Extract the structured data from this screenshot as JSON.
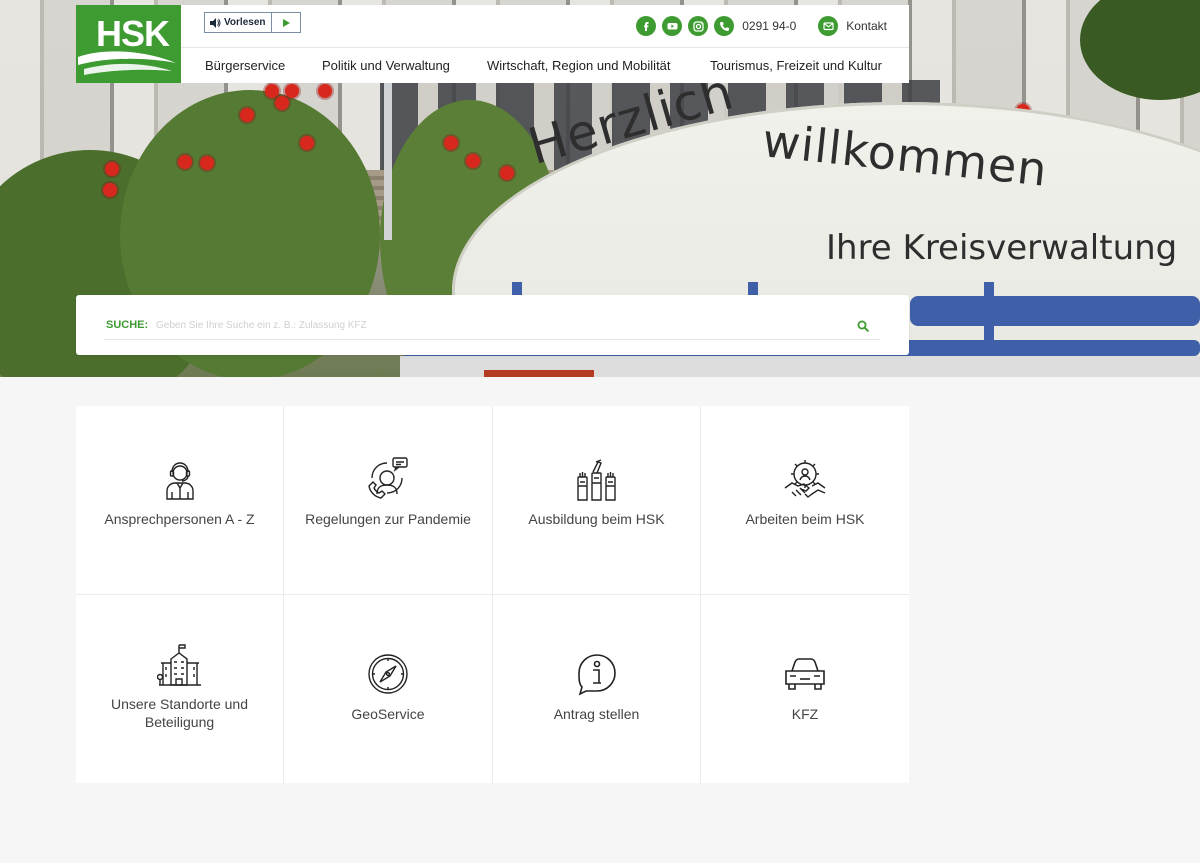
{
  "hero": {
    "sign_line1": "Herzlich",
    "sign_line2": "willkommen",
    "sign_line3": "Ihre Kreisverwaltung"
  },
  "logo": {
    "text": "HSK"
  },
  "vorlesen": {
    "label": "Vorlesen",
    "icon": "speaker-icon",
    "play_icon": "play-icon"
  },
  "topbar": {
    "social": [
      {
        "name": "facebook",
        "icon": "facebook-icon"
      },
      {
        "name": "youtube",
        "icon": "youtube-icon"
      },
      {
        "name": "instagram",
        "icon": "instagram-icon"
      }
    ],
    "phone": "0291 94-0",
    "contact": "Kontakt"
  },
  "nav": {
    "items": [
      {
        "label": "Bürgerservice"
      },
      {
        "label": "Politik und Verwaltung"
      },
      {
        "label": "Wirtschaft, Region und Mobilität"
      },
      {
        "label": "Tourismus, Freizeit und Kultur"
      }
    ]
  },
  "search": {
    "label": "SUCHE:",
    "placeholder": "Geben Sie Ihre Suche ein z. B.: Zulassung KFZ",
    "icon": "search-icon"
  },
  "tiles": [
    {
      "label": "Ansprechpersonen A - Z",
      "icon": "person-headset-icon"
    },
    {
      "label": "Regelungen zur Pandemie",
      "icon": "call-support-icon"
    },
    {
      "label": "Ausbildung beim HSK",
      "icon": "raised-fists-icon"
    },
    {
      "label": "Arbeiten beim HSK",
      "icon": "handshake-gear-icon"
    },
    {
      "label": "Unsere Standorte und Beteiligung",
      "icon": "building-icon"
    },
    {
      "label": "GeoService",
      "icon": "compass-icon"
    },
    {
      "label": "Antrag stellen",
      "icon": "info-bubble-icon"
    },
    {
      "label": "KFZ",
      "icon": "car-icon"
    }
  ],
  "colors": {
    "brand_green": "#3e9b32",
    "text": "#444444",
    "background": "#f6f6f6"
  }
}
